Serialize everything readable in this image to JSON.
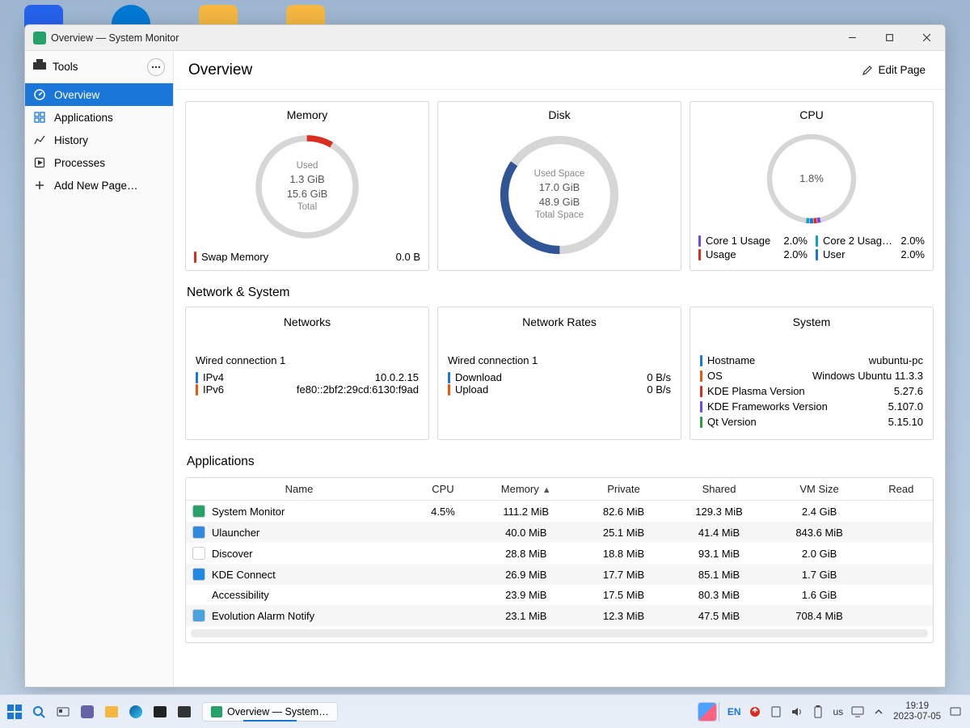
{
  "window": {
    "title": "Overview — System Monitor"
  },
  "sidebar": {
    "tools_label": "Tools",
    "items": [
      {
        "label": "Overview"
      },
      {
        "label": "Applications"
      },
      {
        "label": "History"
      },
      {
        "label": "Processes"
      },
      {
        "label": "Add New Page…"
      }
    ]
  },
  "toolbar": {
    "title": "Overview",
    "edit_label": "Edit Page"
  },
  "cards": {
    "memory": {
      "title": "Memory",
      "used_label": "Used",
      "used_value": "1.3 GiB",
      "total_value": "15.6 GiB",
      "total_label": "Total",
      "swap_label": "Swap Memory",
      "swap_value": "0.0 B"
    },
    "disk": {
      "title": "Disk",
      "used_label": "Used Space",
      "used_value": "17.0 GiB",
      "total_value": "48.9 GiB",
      "total_label": "Total Space"
    },
    "cpu": {
      "title": "CPU",
      "center": "1.8%",
      "legend": [
        {
          "name": "Core 1 Usage",
          "val": "2.0%"
        },
        {
          "name": "Core 2 Usag…",
          "val": "2.0%"
        },
        {
          "name": "Usage",
          "val": "2.0%"
        },
        {
          "name": "User",
          "val": "2.0%"
        }
      ]
    }
  },
  "network_system": {
    "section_title": "Network & System",
    "networks": {
      "title": "Networks",
      "conn": "Wired connection 1",
      "ipv4_label": "IPv4",
      "ipv4_value": "10.0.2.15",
      "ipv6_label": "IPv6",
      "ipv6_value": "fe80::2bf2:29cd:6130:f9ad"
    },
    "rates": {
      "title": "Network Rates",
      "conn": "Wired connection 1",
      "dl_label": "Download",
      "dl_value": "0 B/s",
      "ul_label": "Upload",
      "ul_value": "0 B/s"
    },
    "system": {
      "title": "System",
      "rows": [
        {
          "k": "Hostname",
          "v": "wubuntu-pc"
        },
        {
          "k": "OS",
          "v": "Windows Ubuntu 11.3.3"
        },
        {
          "k": "KDE Plasma Version",
          "v": "5.27.6"
        },
        {
          "k": "KDE Frameworks Version",
          "v": "5.107.0"
        },
        {
          "k": "Qt Version",
          "v": "5.15.10"
        }
      ]
    }
  },
  "apps": {
    "section_title": "Applications",
    "cols": [
      "Name",
      "CPU",
      "Memory",
      "Private",
      "Shared",
      "VM Size",
      "Read"
    ],
    "sort_col": 2,
    "rows": [
      {
        "name": "System Monitor",
        "icon": "#26a269",
        "cpu": "4.5%",
        "memory": "111.2 MiB",
        "private": "82.6 MiB",
        "shared": "129.3 MiB",
        "vmsize": "2.4 GiB",
        "read": ""
      },
      {
        "name": "Ulauncher",
        "icon": "#2e8be0",
        "cpu": "",
        "memory": "40.0 MiB",
        "private": "25.1 MiB",
        "shared": "41.4 MiB",
        "vmsize": "843.6 MiB",
        "read": ""
      },
      {
        "name": "Discover",
        "icon": "#ffffff",
        "cpu": "",
        "memory": "28.8 MiB",
        "private": "18.8 MiB",
        "shared": "93.1 MiB",
        "vmsize": "2.0 GiB",
        "read": ""
      },
      {
        "name": "KDE Connect",
        "icon": "#1e88e5",
        "cpu": "",
        "memory": "26.9 MiB",
        "private": "17.7 MiB",
        "shared": "85.1 MiB",
        "vmsize": "1.7 GiB",
        "read": ""
      },
      {
        "name": "Accessibility",
        "icon": "",
        "cpu": "",
        "memory": "23.9 MiB",
        "private": "17.5 MiB",
        "shared": "80.3 MiB",
        "vmsize": "1.6 GiB",
        "read": ""
      },
      {
        "name": "Evolution Alarm Notify",
        "icon": "#4aa3e0",
        "cpu": "",
        "memory": "23.1 MiB",
        "private": "12.3 MiB",
        "shared": "47.5 MiB",
        "vmsize": "708.4 MiB",
        "read": ""
      }
    ]
  },
  "taskbar": {
    "task_label": "Overview — System…",
    "lang1": "EN",
    "lang2": "us",
    "time": "19:19",
    "date": "2023-07-05"
  },
  "colors": {
    "accent": "#1a76d8",
    "red": "#d92d20",
    "orange": "#e8590c",
    "blue": "#1a76d8",
    "green": "#2e9e44",
    "teal": "#0aa2c0",
    "purple": "#7048e8"
  },
  "chart_data": [
    {
      "type": "pie",
      "title": "Memory",
      "unit": "GiB",
      "series": [
        {
          "name": "Used",
          "value": 1.3
        },
        {
          "name": "Free",
          "value": 14.3
        }
      ],
      "total": 15.6,
      "center_primary": "1.3 GiB",
      "center_secondary": "15.6 GiB"
    },
    {
      "type": "pie",
      "title": "Disk",
      "unit": "GiB",
      "series": [
        {
          "name": "Used Space",
          "value": 17.0
        },
        {
          "name": "Free",
          "value": 31.9
        }
      ],
      "total": 48.9,
      "center_primary": "17.0 GiB",
      "center_secondary": "48.9 GiB"
    },
    {
      "type": "pie",
      "title": "CPU",
      "unit": "%",
      "series": [
        {
          "name": "Core 1 Usage",
          "value": 2.0
        },
        {
          "name": "Core 2 Usage",
          "value": 2.0
        },
        {
          "name": "Usage",
          "value": 2.0
        },
        {
          "name": "User",
          "value": 2.0
        }
      ],
      "ylim": [
        0,
        100
      ],
      "center_primary": "1.8%",
      "legend": [
        "Core 1 Usage",
        "Core 2 Usage",
        "Usage",
        "User"
      ]
    }
  ]
}
